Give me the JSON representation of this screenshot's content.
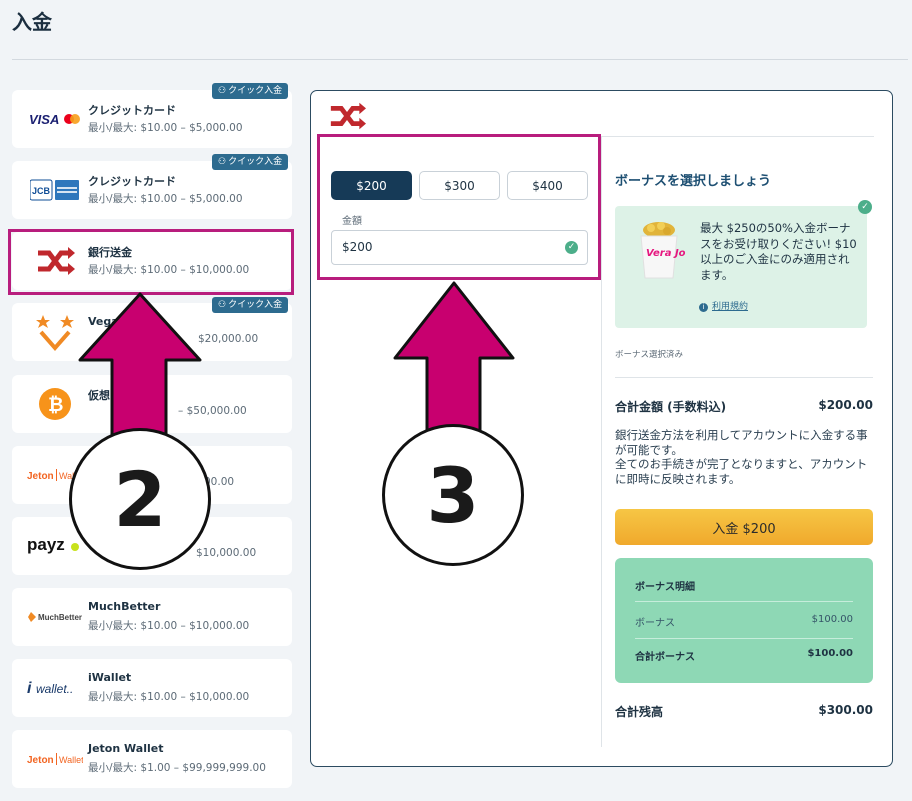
{
  "page": {
    "title": "入金"
  },
  "quick_badge_label": "クイック入金",
  "payment_methods": [
    {
      "name": "クレジットカード",
      "range": "最小/最大: $10.00 – $5,000.00",
      "logo_text": "VISA",
      "quick": true
    },
    {
      "name": "クレジットカード",
      "range": "最小/最大: $10.00 – $5,000.00",
      "logo_text": "JCB",
      "quick": true
    },
    {
      "name": "銀行送金",
      "range": "最小/最大: $10.00 – $10,000.00",
      "quick": false,
      "selected": true
    },
    {
      "name": "Vega",
      "range": "$20,000.00",
      "quick": true
    },
    {
      "name": "仮想",
      "range": "– $50,000.00",
      "quick": false
    },
    {
      "name": "",
      "range": "00.00",
      "logo_text": "Jeton Wallet",
      "quick": false
    },
    {
      "name": "",
      "range": "$10,000.00",
      "logo_text": "payz",
      "quick": false
    },
    {
      "name": "MuchBetter",
      "range": "最小/最大: $10.00 – $10,000.00",
      "logo_text": "MuchBetter",
      "quick": false
    },
    {
      "name": "iWallet",
      "range": "最小/最大: $10.00 – $10,000.00",
      "logo_text": "iwallet",
      "quick": false
    },
    {
      "name": "Jeton Wallet",
      "range": "最小/最大: $1.00 – $99,999,999.00",
      "logo_text": "Jeton Wallet",
      "quick": false
    }
  ],
  "amount_section": {
    "buttons": [
      "$200",
      "$300",
      "$400"
    ],
    "selected": "$200",
    "label": "金額",
    "value": "$200"
  },
  "bonus": {
    "heading": "ボーナスを選択しましょう",
    "card_text": "最大 $250の50%入金ボーナスをお受け取りください! $10以上のご入金にのみ適用されます。",
    "terms_link": "利用規約",
    "selected_text": "ボーナス選択済み",
    "brand_text": "Vera John"
  },
  "summary": {
    "total_label": "合計金額 (手数料込)",
    "total_value": "$200.00",
    "description": "銀行送金方法を利用してアカウントに入金する事が可能です。\n全てのお手続きが完了となりますと、アカウントに即時に反映されます。",
    "deposit_button": "入金 $200"
  },
  "bonus_details": {
    "title": "ボーナス明細",
    "bonus_label": "ボーナス",
    "bonus_value": "$100.00",
    "total_bonus_label": "合計ボーナス",
    "total_bonus_value": "$100.00"
  },
  "balance": {
    "label": "合計残高",
    "value": "$300.00"
  },
  "annotations": {
    "left_number": "2",
    "right_number": "3"
  },
  "colors": {
    "accent_magenta": "#c8006f",
    "navy": "#163a57",
    "deposit_yellow": "#f2b535",
    "bonus_green": "#8ed8b5",
    "bank_icon_red": "#c0282d"
  }
}
